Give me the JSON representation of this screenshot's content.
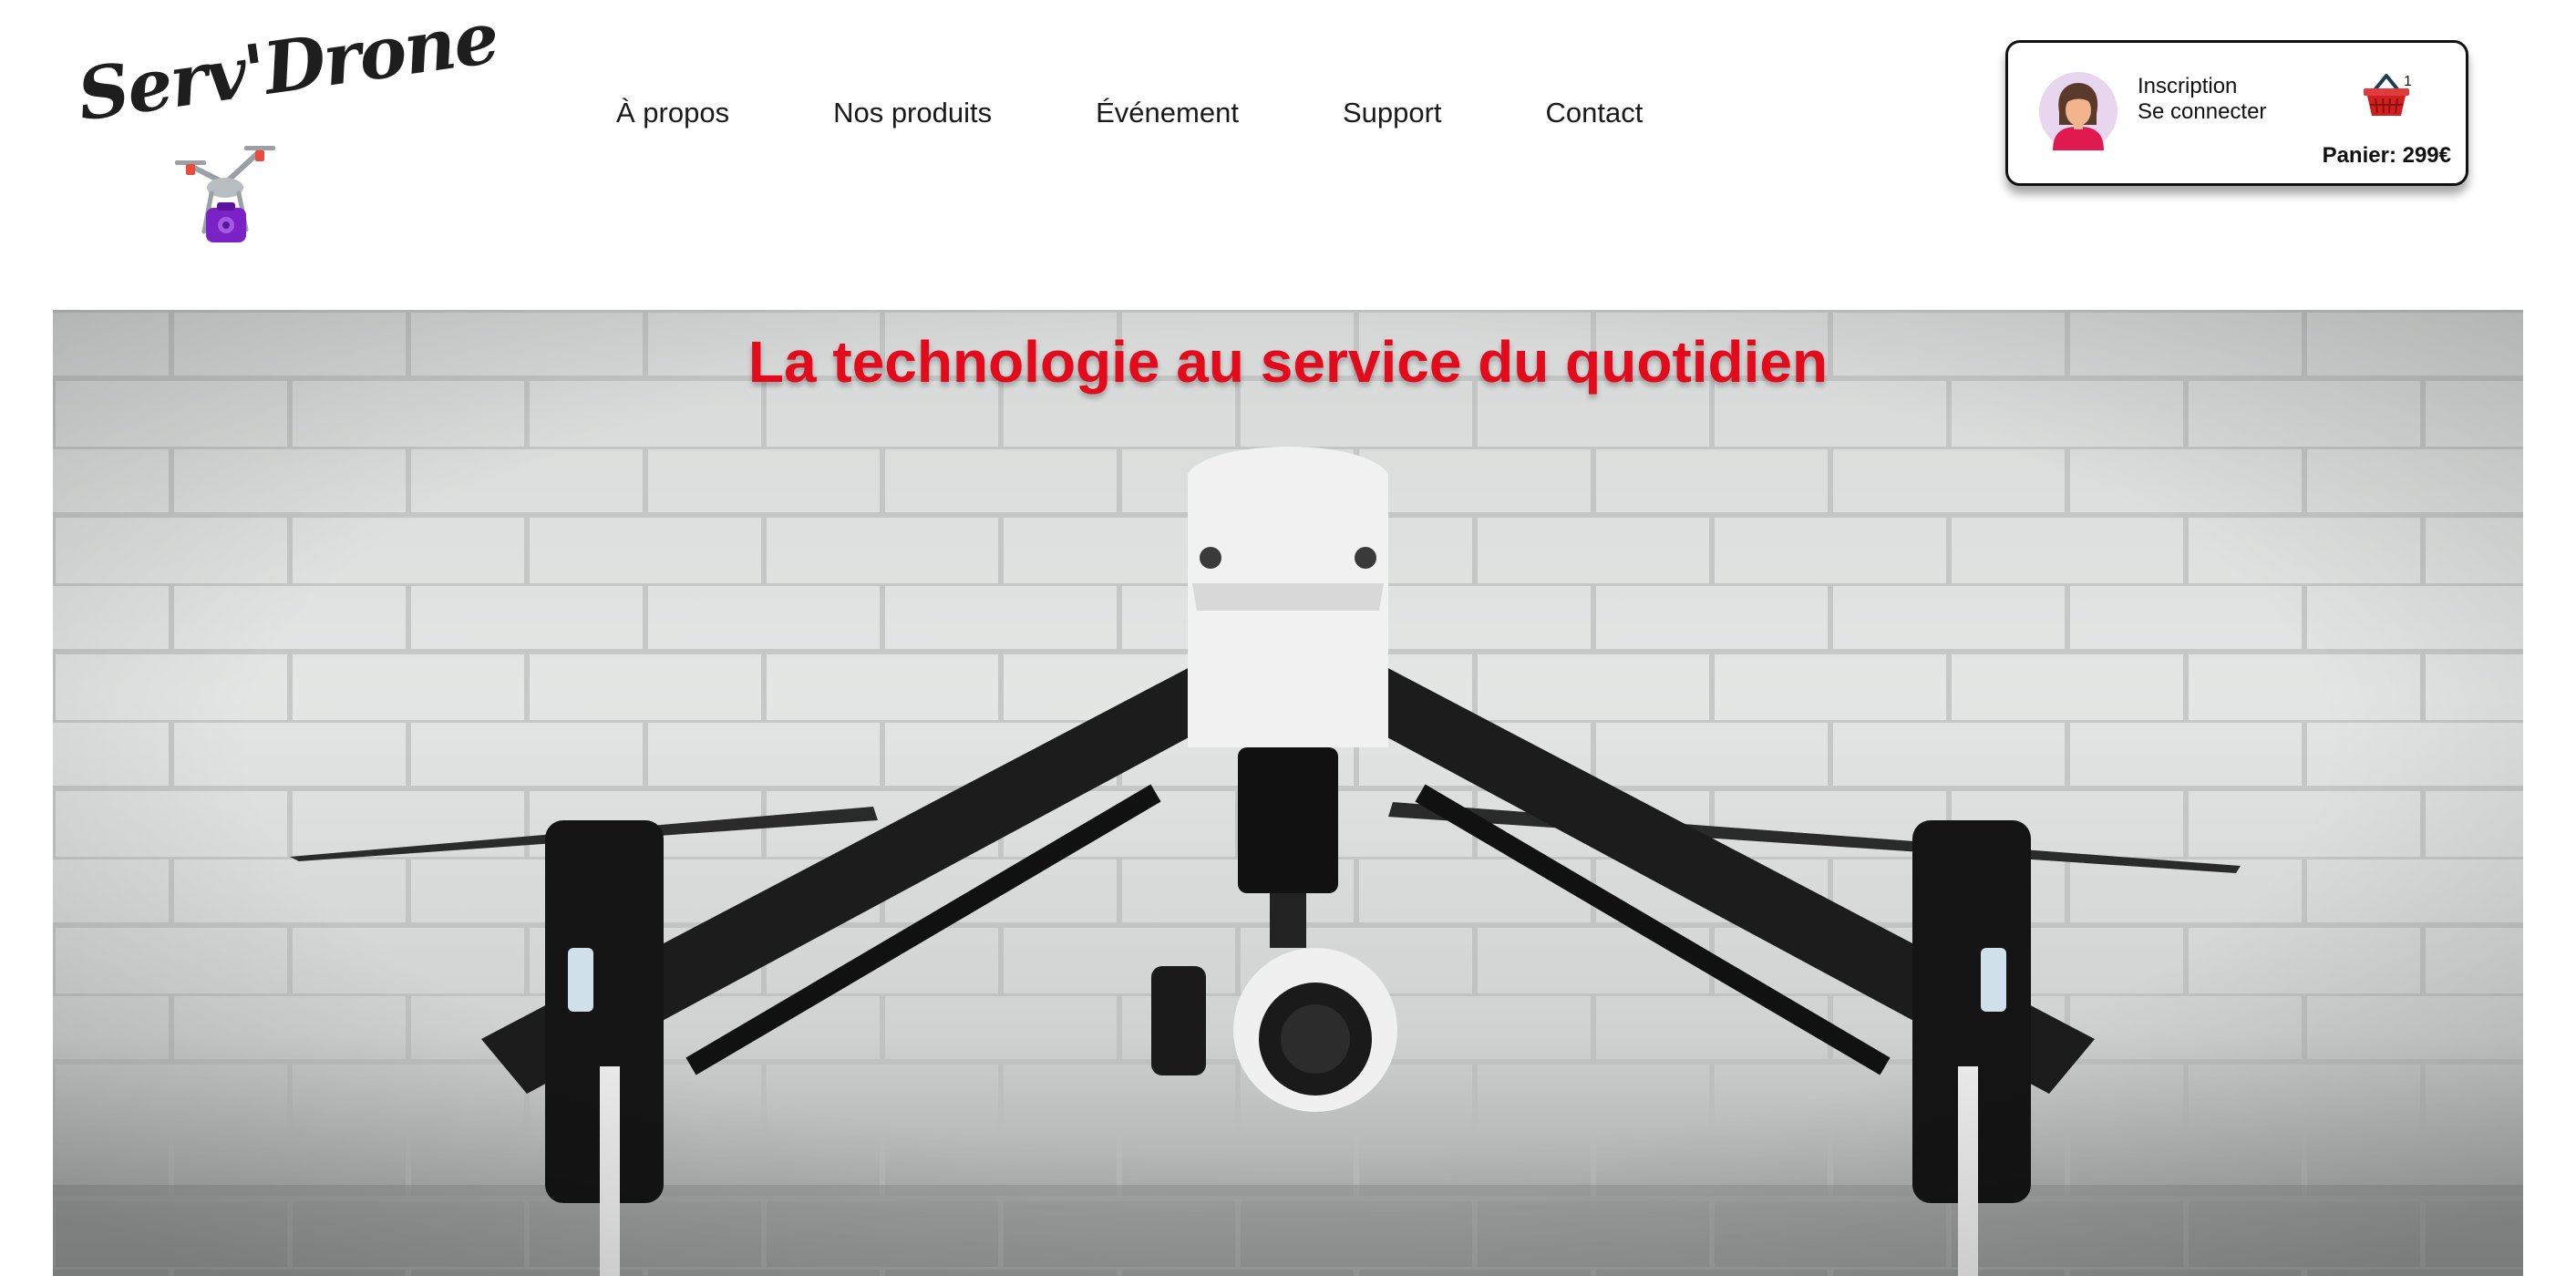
{
  "logo": {
    "text": "Serv'Drone",
    "icon": "drone-with-camera-icon"
  },
  "nav": {
    "items": [
      {
        "label": "À propos"
      },
      {
        "label": "Nos produits"
      },
      {
        "label": "Événement"
      },
      {
        "label": "Support"
      },
      {
        "label": "Contact"
      }
    ]
  },
  "account": {
    "avatar_icon": "user-avatar-icon",
    "signup_label": "Inscription",
    "login_label": "Se connecter",
    "cart_icon": "shopping-basket-icon",
    "cart_count": "1",
    "cart_total": "Panier: 299€"
  },
  "hero": {
    "title": "La technologie au service du quotidien",
    "image": "drone-photo"
  },
  "colors": {
    "accent": "#e30a1b",
    "text": "#1a1a1a",
    "cart": "#d62828",
    "avatar_bg": "#e7d6ee"
  }
}
